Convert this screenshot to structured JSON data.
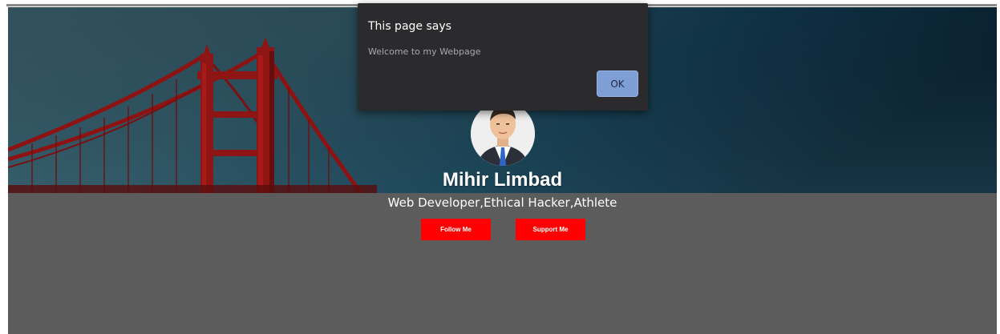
{
  "profile": {
    "name": "Mihir Limbad",
    "tagline": "Web Developer,Ethical Hacker,Athlete",
    "follow_label": "Follow Me",
    "support_label": "Support Me"
  },
  "dialog": {
    "title": "This page says",
    "message": "Welcome to my Webpage",
    "ok_label": "OK"
  },
  "colors": {
    "page_background": "#5c5c5c",
    "button_red": "#ff0000",
    "dialog_background": "#2b2b2d",
    "ok_button": "#7e9ed6",
    "cover_sky_dark": "#0b2a3d",
    "bridge_red": "#8f1212"
  }
}
